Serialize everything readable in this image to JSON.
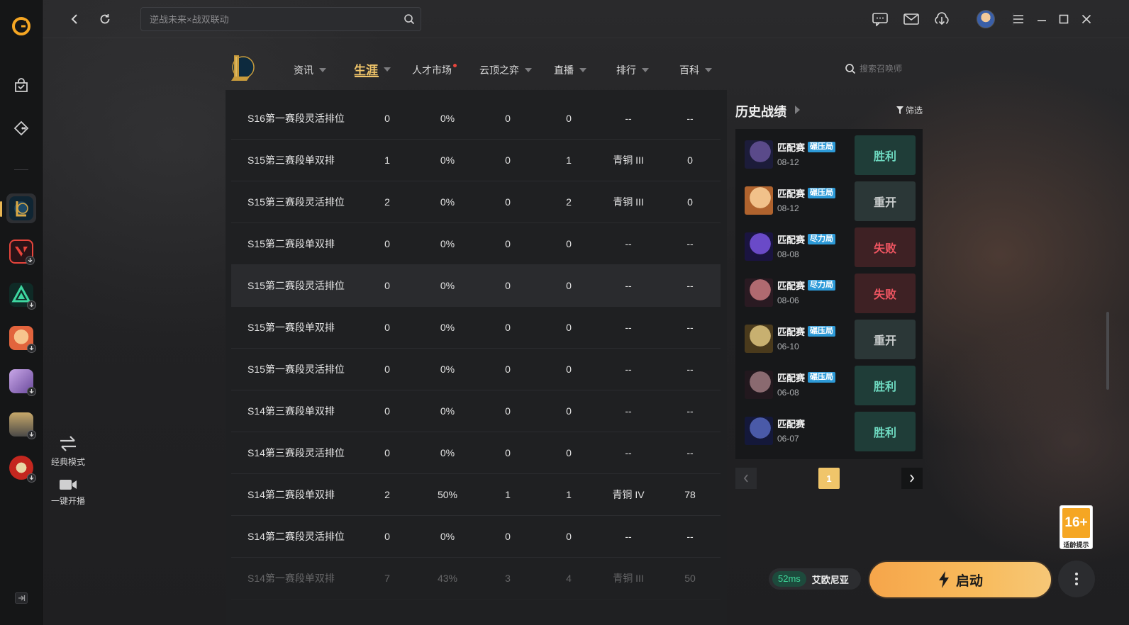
{
  "search": {
    "placeholder": "逆战未来×战双联动"
  },
  "game_nav": {
    "items": [
      {
        "label": "资讯"
      },
      {
        "label": "生涯"
      },
      {
        "label": "人才市场"
      },
      {
        "label": "云顶之弈"
      },
      {
        "label": "直播"
      },
      {
        "label": "排行"
      },
      {
        "label": "百科"
      }
    ],
    "search_placeholder": "搜索召唤师"
  },
  "ranked_table": {
    "rows": [
      [
        "S16第一赛段灵活排位",
        "0",
        "0%",
        "0",
        "0",
        "--",
        "--"
      ],
      [
        "S15第三赛段单双排",
        "1",
        "0%",
        "0",
        "1",
        "青铜 III",
        "0"
      ],
      [
        "S15第三赛段灵活排位",
        "2",
        "0%",
        "0",
        "2",
        "青铜 III",
        "0"
      ],
      [
        "S15第二赛段单双排",
        "0",
        "0%",
        "0",
        "0",
        "--",
        "--"
      ],
      [
        "S15第二赛段灵活排位",
        "0",
        "0%",
        "0",
        "0",
        "--",
        "--"
      ],
      [
        "S15第一赛段单双排",
        "0",
        "0%",
        "0",
        "0",
        "--",
        "--"
      ],
      [
        "S15第一赛段灵活排位",
        "0",
        "0%",
        "0",
        "0",
        "--",
        "--"
      ],
      [
        "S14第三赛段单双排",
        "0",
        "0%",
        "0",
        "0",
        "--",
        "--"
      ],
      [
        "S14第三赛段灵活排位",
        "0",
        "0%",
        "0",
        "0",
        "--",
        "--"
      ],
      [
        "S14第二赛段单双排",
        "2",
        "50%",
        "1",
        "1",
        "青铜 IV",
        "78"
      ],
      [
        "S14第二赛段灵活排位",
        "0",
        "0%",
        "0",
        "0",
        "--",
        "--"
      ],
      [
        "S14第一赛段单双排",
        "7",
        "43%",
        "3",
        "4",
        "青铜 III",
        "50"
      ]
    ]
  },
  "history": {
    "title": "历史战绩",
    "filter_label": "筛选",
    "matches": [
      {
        "mode": "匹配赛",
        "tag": "碾压局",
        "date": "08-12",
        "result": "胜利",
        "type": "win"
      },
      {
        "mode": "匹配赛",
        "tag": "碾压局",
        "date": "08-12",
        "result": "重开",
        "type": "remake"
      },
      {
        "mode": "匹配赛",
        "tag": "尽力局",
        "date": "08-08",
        "result": "失败",
        "type": "lose"
      },
      {
        "mode": "匹配赛",
        "tag": "尽力局",
        "date": "08-06",
        "result": "失败",
        "type": "lose"
      },
      {
        "mode": "匹配赛",
        "tag": "碾压局",
        "date": "06-10",
        "result": "重开",
        "type": "remake"
      },
      {
        "mode": "匹配赛",
        "tag": "碾压局",
        "date": "06-08",
        "result": "胜利",
        "type": "win"
      },
      {
        "mode": "匹配赛",
        "tag": "",
        "date": "06-07",
        "result": "胜利",
        "type": "win"
      }
    ],
    "page": "1"
  },
  "side_actions": {
    "classic_mode": "经典模式",
    "one_click_stream": "一键开播"
  },
  "bottom": {
    "ping": "52ms",
    "server": "艾欧尼亚",
    "launch_label": "启动",
    "age_rating": "16+",
    "age_rating_note": "适龄提示"
  },
  "colors": {
    "accent": "#f0c56a",
    "win": "#6ed9c0",
    "lose": "#ee5561",
    "launch": "#f6a54a"
  }
}
